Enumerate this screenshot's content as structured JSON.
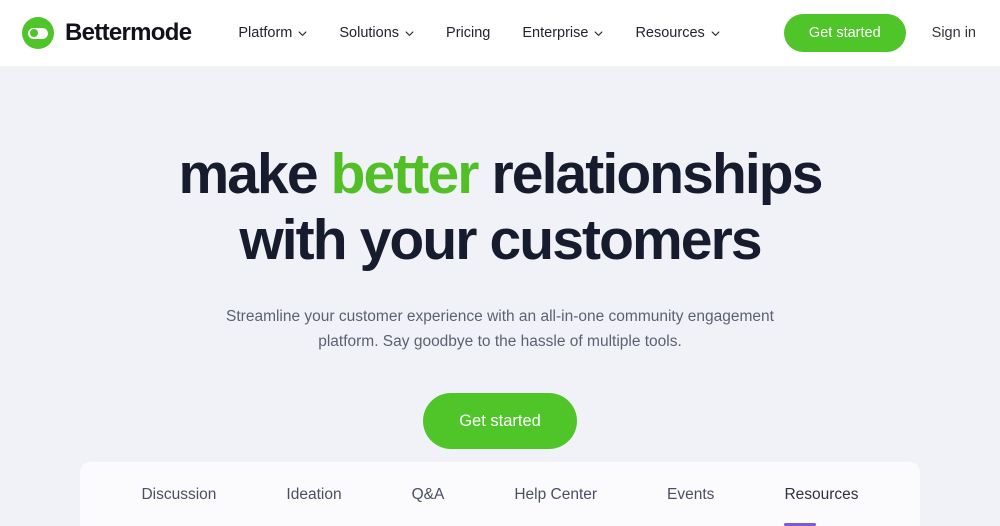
{
  "header": {
    "brand_name": "Bettermode",
    "logo_icon": "bettermode-toggle-logo",
    "nav": [
      {
        "label": "Platform",
        "has_dropdown": true,
        "icon": "chevron-down-icon"
      },
      {
        "label": "Solutions",
        "has_dropdown": true,
        "icon": "chevron-down-icon"
      },
      {
        "label": "Pricing",
        "has_dropdown": false,
        "icon": ""
      },
      {
        "label": "Enterprise",
        "has_dropdown": true,
        "icon": "chevron-down-icon"
      },
      {
        "label": "Resources",
        "has_dropdown": true,
        "icon": "chevron-down-icon"
      }
    ],
    "cta_label": "Get started",
    "signin_label": "Sign in"
  },
  "hero": {
    "headline_part1": "make ",
    "headline_accent": "better",
    "headline_part2": " relationships",
    "headline_line2": "with your customers",
    "subtitle": "Streamline your customer experience with an all-in-one community engagement platform. Say goodbye to the hassle of multiple tools.",
    "cta_label": "Get started"
  },
  "tabs": [
    {
      "label": "Discussion",
      "active": false
    },
    {
      "label": "Ideation",
      "active": false
    },
    {
      "label": "Q&A",
      "active": false
    },
    {
      "label": "Help Center",
      "active": false
    },
    {
      "label": "Events",
      "active": false
    },
    {
      "label": "Resources",
      "active": true
    }
  ],
  "colors": {
    "brand_green": "#4fc52a",
    "headline_accent_green": "#52bf26",
    "headline_navy": "#161b2e",
    "hero_background": "#f1f2f7",
    "active_tab_underline": "#7c5cd6"
  }
}
